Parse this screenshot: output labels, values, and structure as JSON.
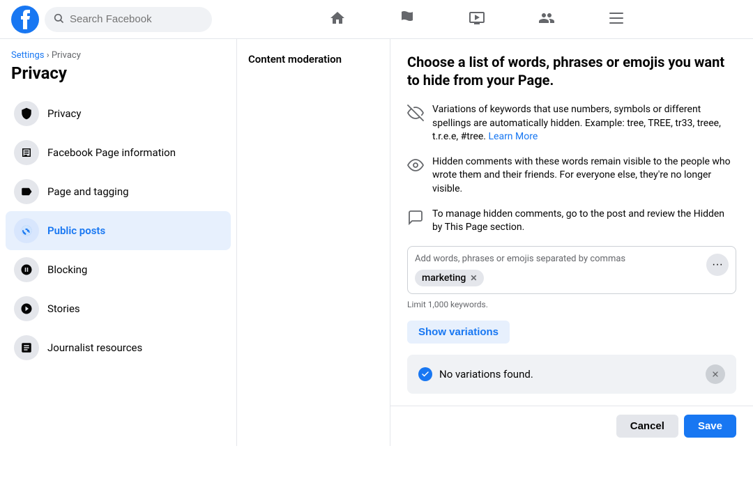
{
  "brand": {
    "logo_alt": "Facebook"
  },
  "nav": {
    "search_placeholder": "Search Facebook",
    "icons": [
      {
        "name": "home-icon",
        "label": "Home"
      },
      {
        "name": "flag-icon",
        "label": "Pages"
      },
      {
        "name": "play-icon",
        "label": "Watch"
      },
      {
        "name": "friends-icon",
        "label": "Friends"
      },
      {
        "name": "menu-icon",
        "label": "Menu"
      }
    ]
  },
  "sidebar": {
    "breadcrumb_parent": "Settings",
    "breadcrumb_separator": " › ",
    "breadcrumb_current": "Privacy",
    "title": "Privacy",
    "items": [
      {
        "id": "privacy",
        "label": "Privacy"
      },
      {
        "id": "page-info",
        "label": "Facebook Page information"
      },
      {
        "id": "page-tagging",
        "label": "Page and tagging"
      },
      {
        "id": "public-posts",
        "label": "Public posts"
      },
      {
        "id": "blocking",
        "label": "Blocking"
      },
      {
        "id": "stories",
        "label": "Stories"
      },
      {
        "id": "journalist",
        "label": "Journalist resources"
      }
    ],
    "active_item": "public-posts"
  },
  "middle": {
    "title": "Content moderation"
  },
  "right": {
    "title": "Choose a list of words, phrases or emojis you want to hide from your Page.",
    "info_rows": [
      {
        "id": "variations",
        "text_before": "Variations of keywords that use numbers, symbols or different spellings are automatically hidden. Example: tree, TREE, tr33, treee, t.r.e.e, #tree.",
        "link_text": "Learn More",
        "link_url": "#"
      },
      {
        "id": "hidden-comments",
        "text": "Hidden comments with these words remain visible to the people who wrote them and their friends. For everyone else, they're no longer visible."
      },
      {
        "id": "manage-hidden",
        "text": "To manage hidden comments, go to the post and review the Hidden by This Page section."
      }
    ],
    "input_placeholder": "Add words, phrases or emojis separated by commas",
    "keywords": [
      {
        "id": "marketing",
        "label": "marketing"
      }
    ],
    "keyword_limit": "Limit 1,000 keywords.",
    "show_variations_btn": "Show variations",
    "no_variations_text": "No variations found.",
    "cancel_btn": "Cancel",
    "save_btn": "Save"
  }
}
